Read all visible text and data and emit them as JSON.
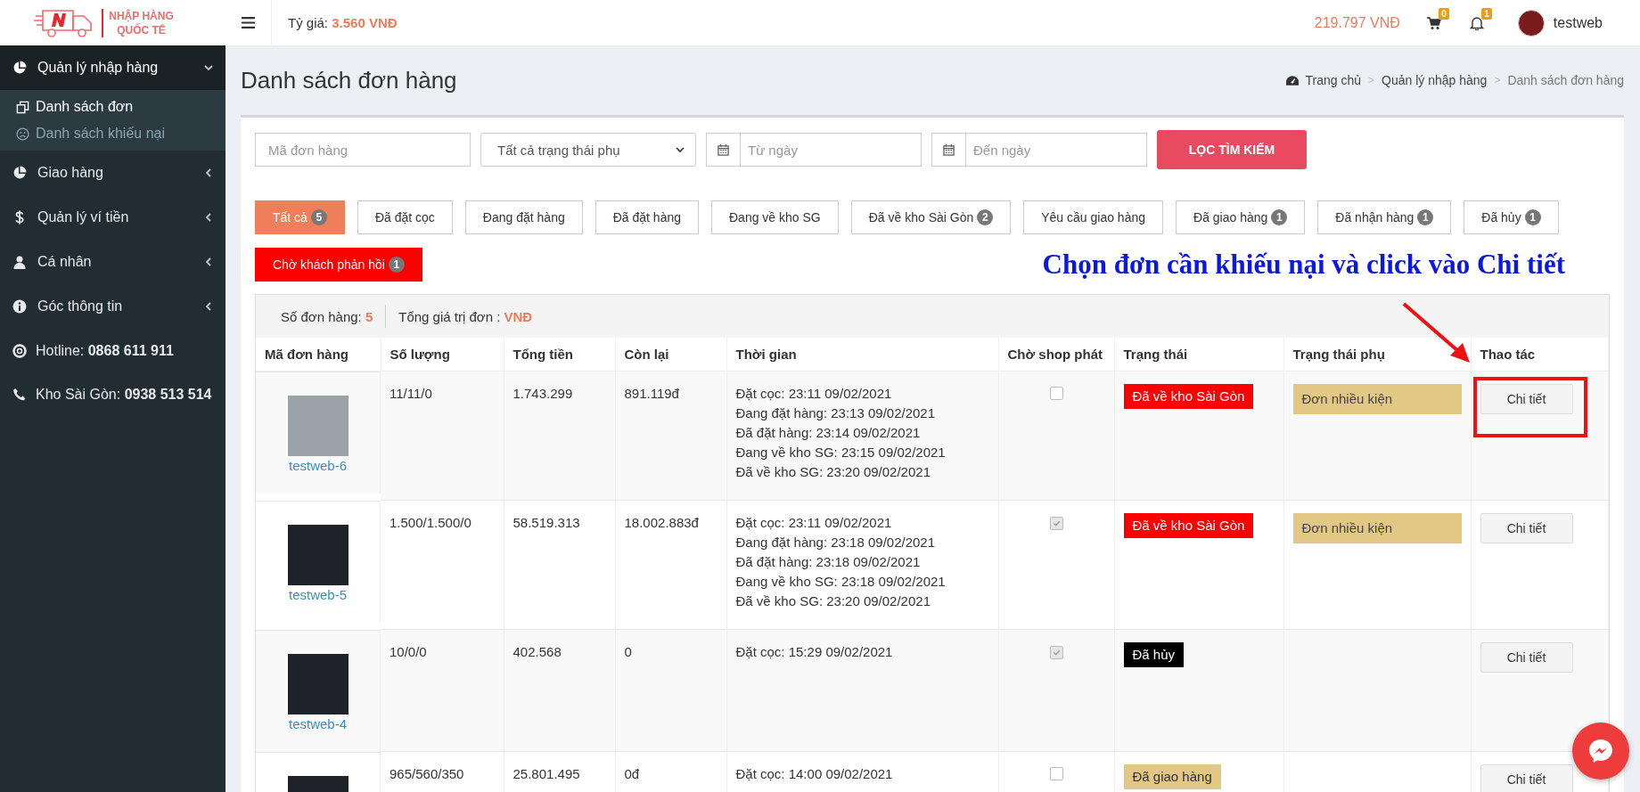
{
  "header": {
    "logo_line_1": "NHẬP HÀNG",
    "logo_line_2": "QUỐC TẾ",
    "exchange_label": "Tỷ giá:",
    "exchange_value": "3.560 VNĐ",
    "balance": "219.797 VNĐ",
    "cart_count": "0",
    "notification_count": "1",
    "username": "testweb"
  },
  "sidebar": {
    "items": [
      {
        "label": "Quản lý nhập hàng",
        "expanded": true,
        "children": [
          {
            "label": "Danh sách đơn",
            "selected": true
          },
          {
            "label": "Danh sách khiếu nại",
            "selected": false
          }
        ]
      },
      {
        "label": "Giao hàng",
        "expanded": false
      },
      {
        "label": "Quản lý ví tiền",
        "expanded": false
      },
      {
        "label": "Cá nhân",
        "expanded": false
      },
      {
        "label": "Góc thông tin",
        "expanded": false
      }
    ],
    "contacts": [
      {
        "label": "Hotline:",
        "value": "0868 611 911"
      },
      {
        "label": "Kho Sài Gòn:",
        "value": "0938 513 514"
      }
    ]
  },
  "page": {
    "title": "Danh sách đơn hàng",
    "breadcrumb": [
      {
        "label": "Trang chủ"
      },
      {
        "separator": ">",
        "label": "Quản lý nhập hàng"
      },
      {
        "separator": ">",
        "label": "Danh sách đơn hàng"
      }
    ]
  },
  "filters": {
    "order_code": {
      "placeholder": "Mã đơn hàng"
    },
    "substatus": {
      "value": "Tất cả trạng thái phụ"
    },
    "from_date": {
      "placeholder": "Từ ngày"
    },
    "to_date": {
      "placeholder": "Đến ngày"
    },
    "search_button": "LỌC TÌM KIẾM"
  },
  "status_tabs": [
    {
      "label": "Tất cả",
      "count": "5",
      "selected": true,
      "kind": "normal"
    },
    {
      "label": "Đã đặt cọc",
      "selected": false,
      "kind": "normal"
    },
    {
      "label": "Đang đặt hàng",
      "selected": false,
      "kind": "normal"
    },
    {
      "label": "Đã đặt hàng",
      "selected": false,
      "kind": "normal"
    },
    {
      "label": "Đang về kho SG",
      "selected": false,
      "kind": "normal"
    },
    {
      "label": "Đã về kho Sài Gòn",
      "count": "2",
      "selected": false,
      "kind": "normal"
    },
    {
      "label": "Yêu cầu giao hàng",
      "selected": false,
      "kind": "normal"
    },
    {
      "label": "Đã giao hàng",
      "count": "1",
      "selected": false,
      "kind": "normal"
    },
    {
      "label": "Đã nhận hàng",
      "count": "1",
      "selected": false,
      "kind": "normal"
    },
    {
      "label": "Đã hủy",
      "count": "1",
      "selected": false,
      "kind": "normal"
    },
    {
      "label": "Chờ khách phản hồi",
      "count": "1",
      "selected": false,
      "kind": "alert"
    }
  ],
  "annotation": "Chọn đơn cần khiếu nại và click vào Chi tiết",
  "summary": {
    "order_count_label": "Số đơn hàng:",
    "order_count": "5",
    "total_label": "Tổng giá trị đơn :",
    "total_value": "VNĐ"
  },
  "table": {
    "columns": [
      "Mã đơn hàng",
      "Số lượng",
      "Tổng tiền",
      "Còn lại",
      "Thời gian",
      "Chờ shop phát",
      "Trạng thái",
      "Trạng thái phụ",
      "Thao tác"
    ],
    "rows": [
      {
        "code": "testweb-6",
        "quantity": "11/11/0",
        "total": "1.743.299",
        "remaining": "891.119đ",
        "times": [
          "Đặt cọc: 23:11 09/02/2021",
          "Đang đặt hàng: 23:13 09/02/2021",
          "Đã đặt hàng: 23:14 09/02/2021",
          "Đang về kho SG: 23:15 09/02/2021",
          "Đã về kho SG: 23:20 09/02/2021"
        ],
        "shop_dispatch_checked": false,
        "status": {
          "label": "Đã về kho Sài Gòn",
          "color": "#ff0000"
        },
        "substatus": "Đơn nhiều kiện",
        "action": "Chi tiết",
        "highlighted": true
      },
      {
        "code": "testweb-5",
        "quantity": "1.500/1.500/0",
        "total": "58.519.313",
        "remaining": "18.002.883đ",
        "times": [
          "Đặt cọc: 23:11 09/02/2021",
          "Đang đặt hàng: 23:18 09/02/2021",
          "Đã đặt hàng: 23:18 09/02/2021",
          "Đang về kho SG: 23:18 09/02/2021",
          "Đã về kho SG: 23:20 09/02/2021"
        ],
        "shop_dispatch_checked": true,
        "status": {
          "label": "Đã về kho Sài Gòn",
          "color": "#ff0000"
        },
        "substatus": "Đơn nhiều kiện",
        "action": "Chi tiết",
        "highlighted": false
      },
      {
        "code": "testweb-4",
        "quantity": "10/0/0",
        "total": "402.568",
        "remaining": "0",
        "times": [
          "Đặt cọc: 15:29 09/02/2021"
        ],
        "shop_dispatch_checked": true,
        "status": {
          "label": "Đã hủy",
          "color": "#000000"
        },
        "action": "Chi tiết",
        "highlighted": false
      },
      {
        "quantity": "965/560/350",
        "total": "25.801.495",
        "remaining": "0đ",
        "times": [
          "Đặt cọc: 14:00 09/02/2021"
        ],
        "shop_dispatch_checked": false,
        "status": {
          "label": "Đã giao hàng",
          "color": "#e3c785"
        },
        "action": "Chi tiết",
        "highlighted": false
      }
    ]
  }
}
